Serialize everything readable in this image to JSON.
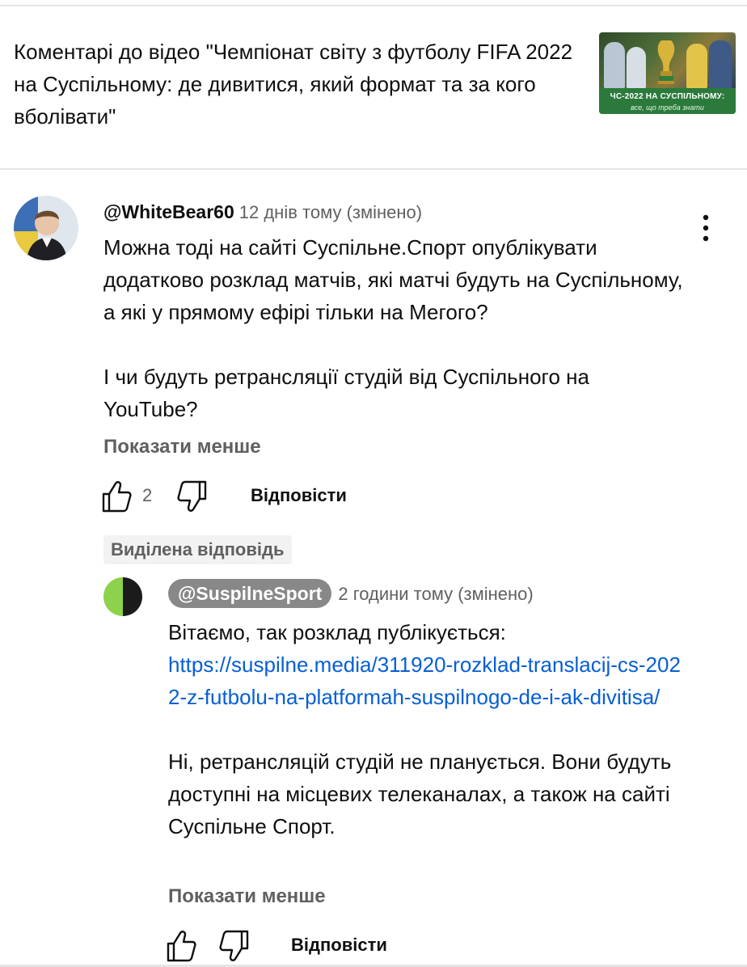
{
  "video": {
    "title": "Коментарі до відео \"Чемпіонат світу з футболу FIFA 2022 на Суспільному: де дивитися, який формат та за кого вболівати\"",
    "thumbnail_caption_main": "ЧС-2022 НА СУСПІЛЬНОМУ:",
    "thumbnail_caption_sub": "все, що треба знати"
  },
  "comment": {
    "author": "@WhiteBear60",
    "timestamp": "12 днів тому (змінено)",
    "paragraph1": "Можна тоді на сайті Суспільне.Спорт опублікувати додатково розклад матчів, які матчі будуть на Суспільному, а які у прямому ефірі тільки на Мегого?",
    "paragraph2": "І чи будуть ретрансляції студій від Суспільного на YouTube?",
    "show_less": "Показати менше",
    "like_count": "2",
    "reply_label": "Відповісти",
    "menu_icon": "more-vert-icon"
  },
  "pinned_label": "Виділена відповідь",
  "reply": {
    "author": "@SuspilneSport",
    "timestamp": "2 години тому (змінено)",
    "text_intro": "Вітаємо, так розклад публікується:",
    "link": "https://suspilne.media/311920-rozklad-translacij-cs-2022-z-futbolu-na-platformah-suspilnogo-de-i-ak-divitisa/",
    "paragraph2": "Ні, ретрансляцій студій не планується. Вони будуть доступні на місцевих телеканалах, а також на сайті Суспільне Спорт.",
    "show_less": "Показати менше",
    "reply_label": "Відповісти"
  },
  "colors": {
    "text_primary": "#0f0f0f",
    "text_secondary": "#606060",
    "link": "#065fd4",
    "author_chip_bg": "#888888",
    "badge_bg": "#f2f2f2",
    "reply_avatar_green": "#8ed14a"
  }
}
